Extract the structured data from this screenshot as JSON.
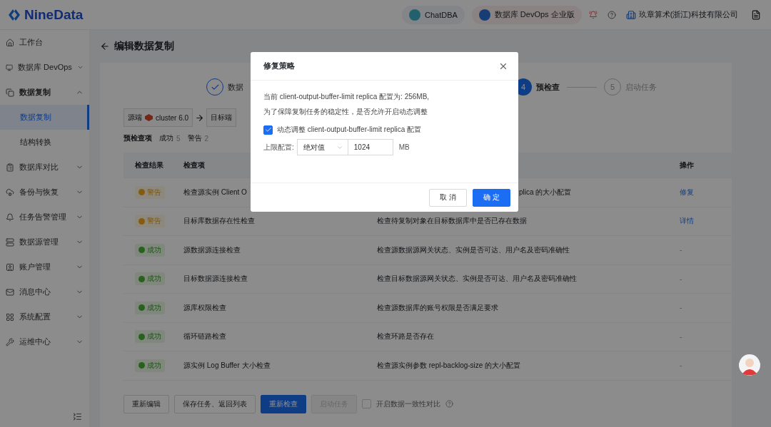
{
  "header": {
    "logo": "NineData",
    "chips": [
      {
        "label": "ChatDBA"
      },
      {
        "label": "数据库 DevOps 企业版"
      }
    ],
    "org": "玖章算术(浙江)科技有限公司"
  },
  "sidebar": {
    "items": [
      {
        "label": "工作台",
        "kind": "link"
      },
      {
        "label": "数据库 DevOps",
        "kind": "group",
        "expanded": false
      },
      {
        "label": "数据复制",
        "kind": "group",
        "expanded": true,
        "children": [
          {
            "label": "数据复制",
            "selected": true
          },
          {
            "label": "结构转换",
            "selected": false
          }
        ]
      },
      {
        "label": "数据库对比",
        "kind": "group",
        "expanded": false
      },
      {
        "label": "备份与恢复",
        "kind": "group",
        "expanded": false
      },
      {
        "label": "任务告警管理",
        "kind": "group",
        "expanded": false
      },
      {
        "label": "数据源管理",
        "kind": "group",
        "expanded": false
      },
      {
        "label": "账户管理",
        "kind": "group",
        "expanded": false
      },
      {
        "label": "消息中心",
        "kind": "group",
        "expanded": false
      },
      {
        "label": "系统配置",
        "kind": "group",
        "expanded": false
      },
      {
        "label": "运维中心",
        "kind": "group",
        "expanded": false
      }
    ]
  },
  "page": {
    "title": "编辑数据复制",
    "steps": [
      {
        "kind": "done",
        "label": "数据"
      },
      {
        "kind": "current",
        "number": "4",
        "label": "预检查"
      },
      {
        "kind": "wait",
        "number": "5",
        "label": "启动任务"
      }
    ],
    "route": {
      "source_label": "源端",
      "source": "cluster 6.0",
      "target_label": "目标端"
    },
    "summary": {
      "title": "预检查项",
      "success_label": "成功",
      "success_count": "5",
      "warning_label": "警告",
      "warning_count": "2"
    },
    "columns": {
      "result": "检查结果",
      "item": "检查项",
      "action": "操作"
    },
    "rows": [
      {
        "kind": "warning",
        "status_label": "警告",
        "item": "检查源实例 Client O",
        "description": "plica 的大小配置",
        "action": "修复"
      },
      {
        "kind": "warning",
        "status_label": "警告",
        "item": "目标库数据存在性检查",
        "description": "检查待复制对象在目标数据库中是否已存在数据",
        "action": "详情"
      },
      {
        "kind": "success",
        "status_label": "成功",
        "item": "源数据源连接检查",
        "description": "检查源数据源网关状态、实例是否可达、用户名及密码准确性",
        "action": "-"
      },
      {
        "kind": "success",
        "status_label": "成功",
        "item": "目标数据源连接检查",
        "description": "检查目标数据源网关状态、实例是否可达、用户名及密码准确性",
        "action": "-"
      },
      {
        "kind": "success",
        "status_label": "成功",
        "item": "源库权限检查",
        "description": "检查源数据库的账号权限是否满足要求",
        "action": "-"
      },
      {
        "kind": "success",
        "status_label": "成功",
        "item": "循环链路检查",
        "description": "检查环路是否存在",
        "action": "-"
      },
      {
        "kind": "success",
        "status_label": "成功",
        "item": "源实例 Log Buffer 大小检查",
        "description": "检查源实例参数 repl-backlog-size 的大小配置",
        "action": "-"
      }
    ],
    "buttons": [
      {
        "label": "重新编辑",
        "kind": "default",
        "disabled": false
      },
      {
        "label": "保存任务、返回列表",
        "kind": "default",
        "disabled": false
      },
      {
        "label": "重新检查",
        "kind": "primary",
        "disabled": false
      },
      {
        "label": "启动任务",
        "kind": "default",
        "disabled": true
      }
    ],
    "compare_option": {
      "label": "开启数据一致性对比",
      "checked": false
    }
  },
  "dialog": {
    "title": "修复策略",
    "lines": [
      "当前 client-output-buffer-limit replica 配置为: 256MB,",
      "为了保障复制任务的稳定性，是否允许开启动态调整"
    ],
    "option": {
      "label": "动态调整 client-output-buffer-limit replica 配置",
      "checked": true
    },
    "limit_label": "上限配置:",
    "select_value": "绝对值",
    "input_value": "1024",
    "unit": "MB",
    "buttons": [
      {
        "label": "取 消",
        "kind": "default"
      },
      {
        "label": "确 定",
        "kind": "primary"
      }
    ]
  }
}
